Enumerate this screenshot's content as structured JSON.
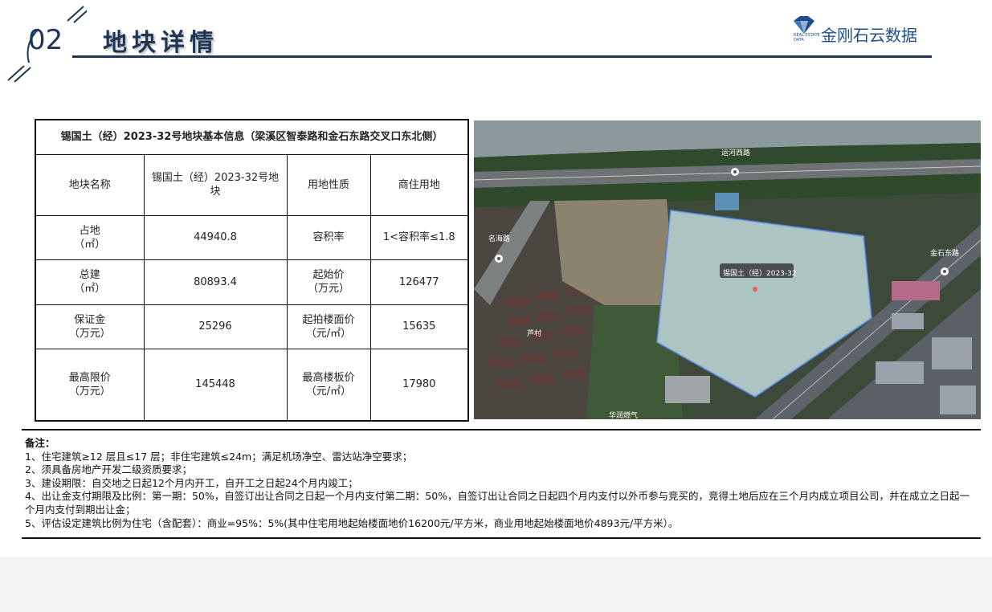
{
  "header": {
    "section_number": "02",
    "title": "地块详情",
    "logo_text": "金刚石云数据",
    "logo_sub": "REAL ESTATE DATA",
    "accent_color": "#1d3557"
  },
  "table": {
    "heading": "锡国土（经）2023-32号地块基本信息（梁溪区智泰路和金石东路交叉口东北侧）",
    "rows": [
      {
        "k1": "地块名称",
        "v1": "锡国土（经）2023-32号地块",
        "k2": "用地性质",
        "v2": "商住用地"
      },
      {
        "k1": "占地\n（㎡）",
        "v1": "44940.8",
        "k2": "容积率",
        "v2": "1<容积率≤1.8"
      },
      {
        "k1": "总建\n（㎡）",
        "v1": "80893.4",
        "k2": "起始价\n（万元）",
        "v2": "126477"
      },
      {
        "k1": "保证金\n（万元）",
        "v1": "25296",
        "k2": "起拍楼面价\n（元/㎡）",
        "v2": "15635"
      },
      {
        "k1": "最高限价\n（万元）",
        "v1": "145448",
        "k2": "最高楼板价\n（元/㎡）",
        "v2": "17980"
      }
    ]
  },
  "map": {
    "road_top": "运河西路",
    "road_left": "名海路",
    "road_right": "金石东路",
    "parcel_label": "锡国土（经）2023-32",
    "village_label": "芦村",
    "bottom_label": "华润燃气"
  },
  "notes": {
    "title": "备注：",
    "items": [
      "1、住宅建筑≥12 层且≤17 层；非住宅建筑≤24m；满足机场净空、雷达站净空要求；",
      "2、须具备房地产开发二级资质要求；",
      "3、建设期限：自交地之日起12个月内开工，自开工之日起24个月内竣工；",
      "4、出让金支付期限及比例：第一期：50%，自签订出让合同之日起一个月内支付第二期：50%，自签订出让合同之日起四个月内支付以外币参与竞买的，竞得土地后应在三个月内成立项目公司，并在成立之日起一个月内支付到期出让金；",
      "5、评估设定建筑比例为住宅（含配套）：商业=95%：5%(其中住宅用地起始楼面地价16200元/平方米，商业用地起始楼面地价4893元/平方米）。"
    ]
  }
}
